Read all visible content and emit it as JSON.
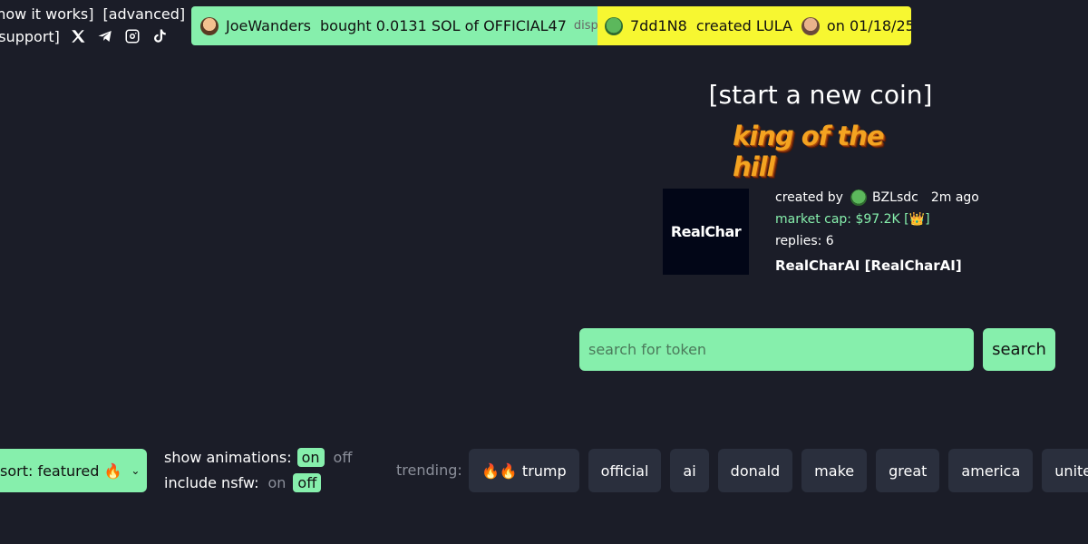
{
  "nav": {
    "how_it_works": "[how it works]",
    "advanced": "[advanced]",
    "support": "[support]",
    "social_icons": [
      "x-icon",
      "telegram-icon",
      "instagram-icon",
      "tiktok-icon"
    ]
  },
  "ticker": {
    "buy": {
      "user": "JoeWanders",
      "text": "bought 0.0131 SOL of OFFICIAL47",
      "trail": "disp"
    },
    "create": {
      "user": "7dd1N8",
      "text": "created LULA",
      "date": "on 01/18/25"
    }
  },
  "main": {
    "start_coin": "[start a new coin]",
    "king_of_hill": "king of the hill",
    "token": {
      "image_text": "RealChar",
      "created_by_label": "created by",
      "creator": "BZLsdc",
      "time_ago": "2m ago",
      "market_cap": "market cap: $97.2K [👑]",
      "replies": "replies: 6",
      "name": "RealCharAI [RealCharAI]"
    }
  },
  "search": {
    "placeholder": "search for token",
    "button": "search"
  },
  "controls": {
    "sort": "sort: featured 🔥",
    "animations_label": "show animations:",
    "animations_on": "on",
    "animations_off": "off",
    "nsfw_label": "include nsfw:",
    "nsfw_on": "on",
    "nsfw_off": "off",
    "trending_label": "trending:",
    "trending": [
      "🔥🔥 trump",
      "official",
      "ai",
      "donald",
      "make",
      "great",
      "america",
      "united"
    ]
  },
  "colors": {
    "background": "#1b1d28",
    "accent_green": "#86efac",
    "accent_yellow": "#f7f731",
    "chip": "#2a2f3d"
  }
}
